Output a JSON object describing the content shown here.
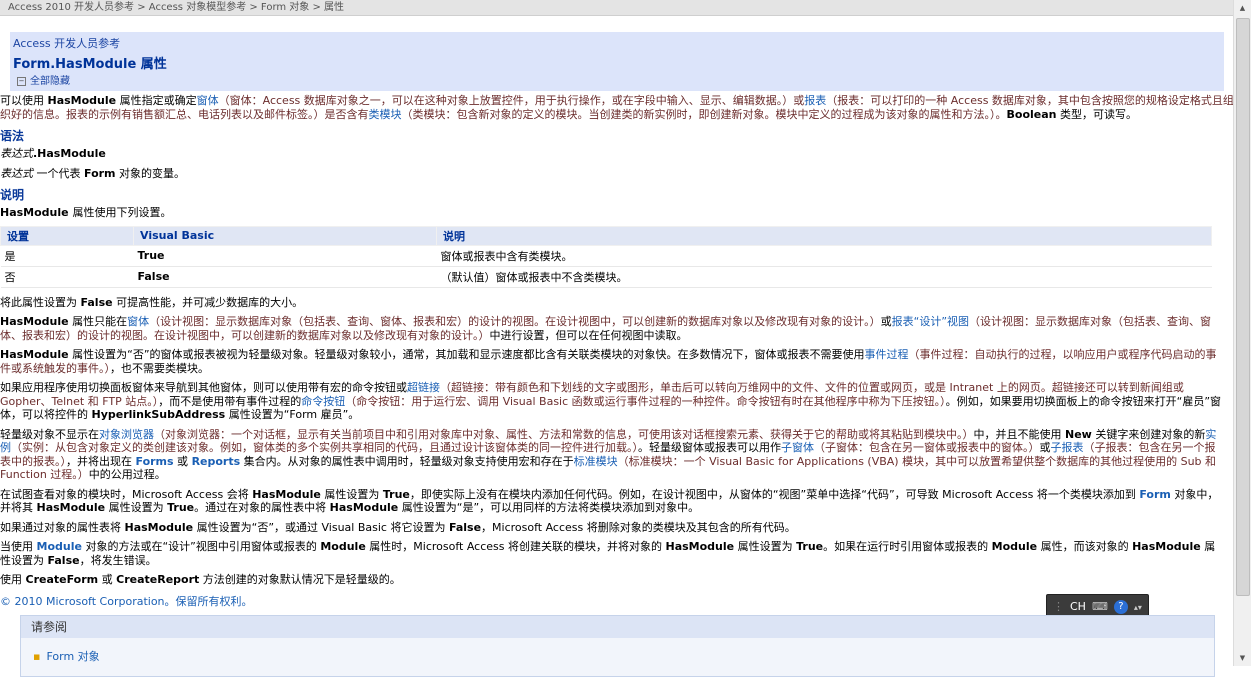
{
  "breadcrumb": "Access 2010 开发人员参考 > Access 对象模型参考 > Form 对象 > 属性",
  "header": {
    "ref": "Access 开发人员参考",
    "title": "Form.HasModule 属性",
    "collapse": "全部隐藏"
  },
  "intro": {
    "a": "可以使用 ",
    "b": "HasModule",
    "c": " 属性指定或确定",
    "d": "窗体",
    "e": "（窗体：Access 数据库对象之一，可以在这种对象上放置控件，用于执行操作，或在字段中输入、显示、编辑数据。）或",
    "f": "报表",
    "g": "（报表：可以打印的一种 Access 数据库对象，其中包含按照您的规格设定格式且组织好的信息。报表的示例有销售额汇总、电话列表以及邮件标签。）是否含有",
    "h": "类模块",
    "i": "（类模块：包含新对象的定义的模块。当创建类的新实例时，即创建新对象。模块中定义的过程成为该对象的属性和方法。）。",
    "j": "Boolean",
    "k": " 类型，可读写。"
  },
  "syntax": {
    "heading": "语法",
    "expr1": "表达式",
    "expr1b": ".HasModule",
    "expr2": "表达式",
    "expr2b": "  一个代表 ",
    "expr2c": "Form",
    "expr2d": " 对象的变量。"
  },
  "remarks": {
    "heading": "说明",
    "line": "属性使用下列设置。",
    "name": "HasModule "
  },
  "settings_table": {
    "headers": [
      "设置",
      "Visual Basic",
      "说明"
    ],
    "rows": [
      [
        "是",
        "True",
        "窗体或报表中含有类模块。"
      ],
      [
        "否",
        "False",
        "（默认值）窗体或报表中不含类模块。"
      ]
    ]
  },
  "p1": {
    "a": "将此属性设置为 ",
    "b": "False",
    "c": " 可提高性能，并可减少数据库的大小。"
  },
  "p2": {
    "a": "HasModule",
    "b": " 属性只能在",
    "c": "窗体",
    "d": "（设计视图：显示数据库对象（包括表、查询、窗体、报表和宏）的设计的视图。在设计视图中，可以创建新的数据库对象以及修改现有对象的设计。）",
    "e": "或",
    "f": "报表“设计”视图",
    "g": "（设计视图：显示数据库对象（包括表、查询、窗体、报表和宏）的设计的视图。在设计视图中，可以创建新的数据库对象以及修改现有对象的设计。）",
    "h": "中进行设置，但可以在任何视图中读取。"
  },
  "p3": {
    "a": "HasModule",
    "b": " 属性设置为“否”的窗体或报表被视为轻量级对象。轻量级对象较小，通常，其加载和显示速度都比含有关联类模块的对象快。在多数情况下，窗体或报表不需要使用",
    "c": "事件过程",
    "d": "（事件过程：自动执行的过程，以响应用户或程序代码启动的事件或系统触发的事件。）",
    "e": "，也不需要类模块。"
  },
  "p4": {
    "a": "如果应用程序使用切换面板窗体来导航到其他窗体，则可以使用带有宏的命令按钮或",
    "b": "超链接",
    "c": "（超链接：带有颜色和下划线的文字或图形，单击后可以转向万维网中的文件、文件的位置或网页，或是 Intranet 上的网页。超链接还可以转到新闻组或 Gopher、Telnet 和 FTP 站点。）",
    "d": "，而不是使用带有事件过程的",
    "e": "命令按钮",
    "f": "（命令按钮：用于运行宏、调用 Visual Basic 函数或运行事件过程的一种控件。命令按钮有时在其他程序中称为下压按钮。）",
    "g": "。例如，如果要用切换面板上的命令按钮来打开“雇员”窗体，可以将控件的 ",
    "h": "HyperlinkSubAddress",
    "i": " 属性设置为“Form 雇员”。"
  },
  "p5": {
    "a": "轻量级对象不显示在",
    "b": "对象浏览器",
    "c": "（对象浏览器：一个对话框，显示有关当前项目中和引用对象库中对象、属性、方法和常数的信息，可使用该对话框搜索元素、获得关于它的帮助或将其粘贴到模块中。）",
    "d": "中，并且不能使用 ",
    "e": "New",
    "f": " 关键字来创建对象的新",
    "g": "实例",
    "h": "（实例：从包含对象定义的类创建该对象。例如，窗体类的多个实例共享相同的代码，且通过设计该窗体类的同一控件进行加载。）",
    "i": "。轻量级窗体或报表可以用作",
    "j": "子窗体",
    "k": "（子窗体：包含在另一窗体或报表中的窗体。）",
    "l": "或",
    "m": "子报表",
    "n": "（子报表：包含在另一个报表中的报表。）",
    "o": "，并将出现在 ",
    "p": "Forms",
    "q": " 或 ",
    "r": "Reports",
    "s": " 集合内。从对象的属性表中调用时，轻量级对象支持使用宏和存在于",
    "t": "标准模块",
    "u": "（标准模块：一个 Visual Basic for Applications (VBA) 模块，其中可以放置希望供整个数据库的其他过程使用的 Sub 和 Function 过程。）",
    "v": "中的公用过程。"
  },
  "p6": {
    "a": "在试图查看对象的模块时，Microsoft Access 会将 ",
    "b": "HasModule",
    "c": " 属性设置为 ",
    "d": "True",
    "e": "，即使实际上没有在模块内添加任何代码。例如，在设计视图中，从窗体的“视图”菜单中选择“代码”，可导致 Microsoft Access 将一个类模块添加到 ",
    "f": "Form",
    "g": " 对象中，并将其 ",
    "h": "HasModule",
    "i": " 属性设置为 ",
    "j": "True",
    "k": "。通过在对象的属性表中将 ",
    "l": "HasModule",
    "m": " 属性设置为“是”，可以用同样的方法将类模块添加到对象中。"
  },
  "p7": {
    "a": "如果通过对象的属性表将 ",
    "b": "HasModule",
    "c": " 属性设置为“否”，或通过 Visual Basic 将它设置为 ",
    "d": "False",
    "e": "，Microsoft Access 将删除对象的类模块及其包含的所有代码。"
  },
  "p8": {
    "a": "当使用 ",
    "b": "Module",
    "c": " 对象的方法或在“设计”视图中引用窗体或报表的 ",
    "d": "Module",
    "e": " 属性时，Microsoft Access 将创建关联的模块，并将对象的 ",
    "f": "HasModule",
    "g": " 属性设置为 ",
    "h": "True",
    "i": "。如果在运行时引用窗体或报表的 ",
    "j": "Module",
    "k": " 属性，而该对象的 ",
    "l": "HasModule",
    "m": " 属性设置为 ",
    "n": "False",
    "o": "，将发生错误。"
  },
  "p9": {
    "a": "使用 ",
    "b": "CreateForm",
    "c": " 或 ",
    "d": "CreateReport",
    "e": " 方法创建的对象默认情况下是轻量级的。"
  },
  "copyright": "© 2010 Microsoft Corporation。保留所有权利。",
  "see_also": {
    "heading": "请参阅",
    "item": "Form 对象"
  },
  "ime": {
    "lang": "CH"
  }
}
